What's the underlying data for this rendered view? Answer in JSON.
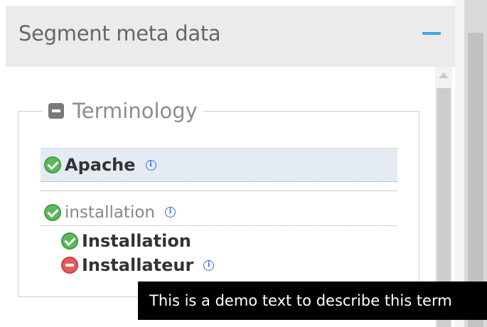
{
  "panel": {
    "title": "Segment meta data",
    "collapse_icon": "minus-icon",
    "accent_color": "#4aa3df"
  },
  "terminology": {
    "legend_label": "Terminology",
    "legend_icon": "collapse-square-icon",
    "main_term": {
      "text": "Apache",
      "status": "permitted",
      "status_icon": "check-circle-icon",
      "info_icon": "info-icon"
    },
    "source_term": {
      "text": "installation",
      "status": "permitted",
      "status_icon": "check-circle-icon",
      "info_icon": "info-icon"
    },
    "target_terms": [
      {
        "text": "Installation",
        "status": "permitted",
        "status_icon": "check-circle-icon"
      },
      {
        "text": "Installateur",
        "status": "forbidden",
        "status_icon": "minus-circle-icon",
        "info_icon": "info-icon"
      }
    ]
  },
  "tooltip": {
    "text": "This is a demo text to describe this term"
  },
  "colors": {
    "permitted": "#5cb85c",
    "forbidden": "#e55b5b",
    "highlight_row": "#e4ebf3",
    "info": "#3b6fd8"
  }
}
